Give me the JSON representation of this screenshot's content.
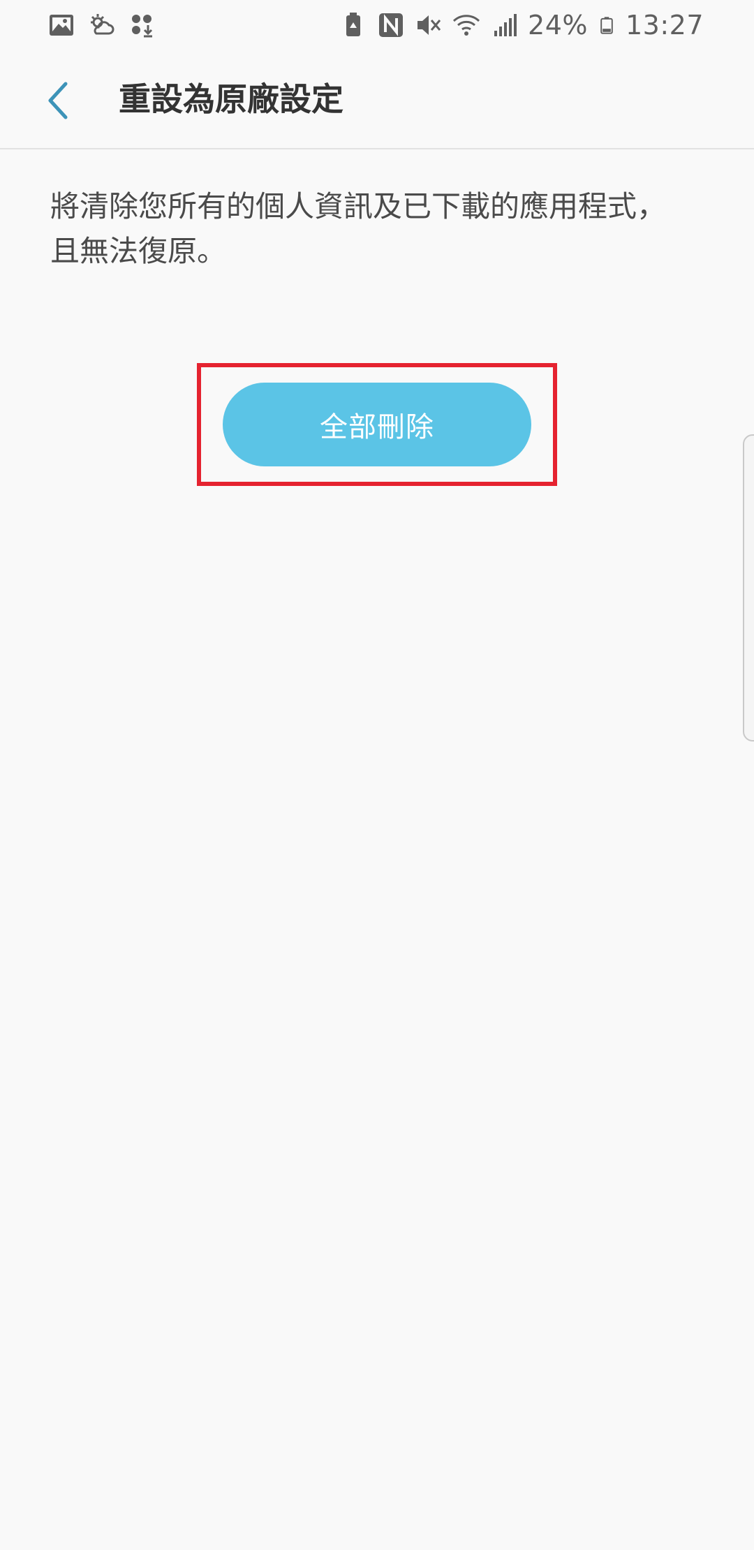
{
  "status_bar": {
    "left_icons": [
      "gallery-icon",
      "weather-icon",
      "download-icon"
    ],
    "right_icons": [
      "battery-saver-icon",
      "nfc-icon",
      "mute-icon",
      "wifi-icon",
      "signal-icon"
    ],
    "battery_percent": "24%",
    "time": "13:27"
  },
  "header": {
    "back_icon": "chevron-left-icon",
    "title": "重設為原廠設定"
  },
  "main": {
    "description_line1": "將清除您所有的個人資訊及已下載的應用程式，",
    "description_line2": "且無法復原。",
    "delete_button_label": "全部刪除"
  },
  "colors": {
    "accent": "#5bc4e6",
    "back_icon": "#3d93b8",
    "highlight": "#e52330",
    "background": "#f9f9f9"
  }
}
